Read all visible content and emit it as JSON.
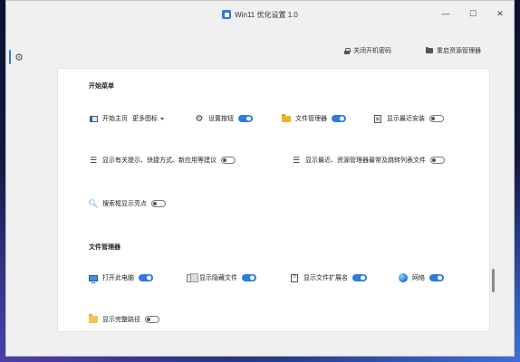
{
  "window": {
    "title": "Win11 优化设置 1.0",
    "controls": {
      "minimize": "—",
      "maximize": "☐",
      "close": "✕"
    }
  },
  "sidebar": {
    "items": [
      {
        "icon": "gear-icon",
        "label": "设置",
        "active": true
      }
    ]
  },
  "top_actions": {
    "disable_password": "关闭开机密码",
    "restart_explorer": "重启资源管理器"
  },
  "start_menu": {
    "title": "开始菜单",
    "start_home": {
      "label": "开始主页",
      "dropdown_value": "更多图标"
    },
    "settings_button": {
      "label": "设置按钮",
      "on": true
    },
    "file_manager": {
      "label": "文件管理器",
      "on": true
    },
    "recent_installs": {
      "label": "显示最近安装",
      "on": false
    },
    "tips": {
      "label": "显示有关提示、快捷方式、新应用等建议",
      "on": false
    },
    "recent_opened": {
      "label": "显示最近、资源管理器最常及跳转列表文件",
      "on": false
    },
    "search_highlights": {
      "label": "搜索框显示亮点",
      "on": false
    }
  },
  "file_explorer": {
    "title": "文件管理器",
    "open_this_pc": {
      "label": "打开此电脑",
      "on": true
    },
    "show_hidden": {
      "label": "显示隐藏文件",
      "on": true
    },
    "show_ext": {
      "label": "显示文件扩展名",
      "on": true
    },
    "network": {
      "label": "网络",
      "on": true
    },
    "full_path": {
      "label": "显示完整路径",
      "on": false
    }
  },
  "colors": {
    "accent": "#2d7be0",
    "panel": "#ffffff",
    "window": "#f0f0f0"
  }
}
